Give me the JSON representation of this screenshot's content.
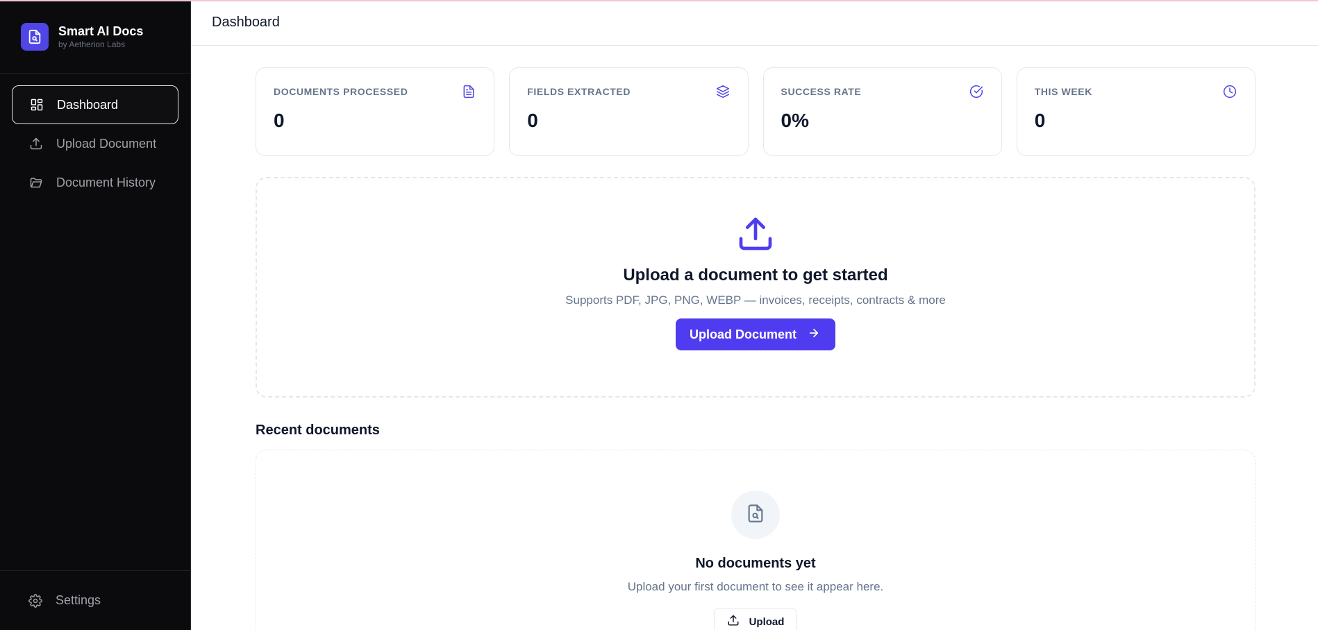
{
  "brand": {
    "name": "Smart AI Docs",
    "subtitle": "by Aetherion Labs",
    "accent": "#4f46e5"
  },
  "sidebar": {
    "items": [
      {
        "label": "Dashboard",
        "icon": "dashboard-grid-icon",
        "active": true
      },
      {
        "label": "Upload Document",
        "icon": "upload-icon",
        "active": false
      },
      {
        "label": "Document History",
        "icon": "folder-open-icon",
        "active": false
      }
    ],
    "settings_label": "Settings",
    "settings_icon": "gear-icon"
  },
  "header": {
    "title": "Dashboard"
  },
  "stats": [
    {
      "label": "DOCUMENTS PROCESSED",
      "value": "0",
      "icon": "file-text-icon"
    },
    {
      "label": "FIELDS EXTRACTED",
      "value": "0",
      "icon": "layers-icon"
    },
    {
      "label": "SUCCESS RATE",
      "value": "0%",
      "icon": "check-circle-icon"
    },
    {
      "label": "THIS WEEK",
      "value": "0",
      "icon": "clock-icon"
    }
  ],
  "upload": {
    "title": "Upload a document to get started",
    "description": "Supports PDF, JPG, PNG, WEBP — invoices, receipts, contracts & more",
    "button_label": "Upload Document"
  },
  "recent": {
    "title": "Recent documents",
    "empty_title": "No documents yet",
    "empty_description": "Upload your first document to see it appear here.",
    "button_label": "Upload"
  },
  "colors": {
    "primary": "#4f3cf0",
    "sidebar_bg": "#0b0b0d",
    "muted_text": "#64748b"
  }
}
